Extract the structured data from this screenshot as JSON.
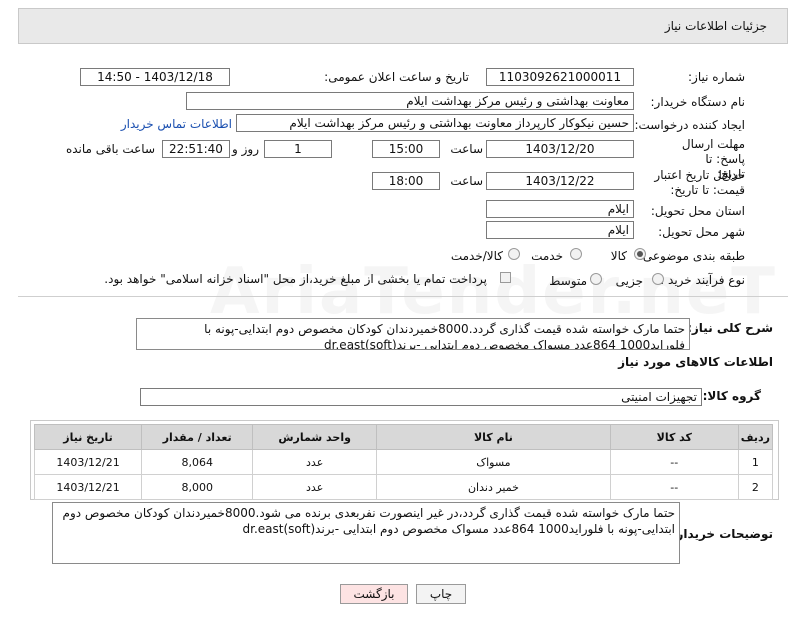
{
  "panel": {
    "title": "جزئیات اطلاعات نیاز"
  },
  "need_number": {
    "label": "شماره نیاز:",
    "value": "1103092621000011"
  },
  "announce": {
    "label": "تاریخ و ساعت اعلان عمومی:",
    "value": "1403/12/18 - 14:50"
  },
  "buyer_org": {
    "label": "نام دستگاه خریدار:",
    "value": "معاونت بهداشتی و رئیس مرکز بهداشت ایلام"
  },
  "creator": {
    "label": "ایجاد کننده درخواست:",
    "value": "حسین  نیکوکار کارپرداز  معاونت بهداشتی و رئیس مرکز بهداشت ایلام",
    "contact_link": "اطلاعات تماس خریدار"
  },
  "reply_deadline": {
    "label": "مهلت ارسال پاسخ: تا تاریخ:",
    "date": "1403/12/20",
    "time_label": "ساعت",
    "time": "15:00",
    "days": "1",
    "days_label": "روز و",
    "remaining": "22:51:40",
    "remaining_label": "ساعت باقی مانده"
  },
  "price_validity": {
    "label": "حداقل تاریخ اعتبار قیمت: تا تاریخ:",
    "date": "1403/12/22",
    "time_label": "ساعت",
    "time": "18:00"
  },
  "delivery_province": {
    "label": "استان محل تحویل:",
    "value": "ایلام"
  },
  "delivery_city": {
    "label": "شهر محل تحویل:",
    "value": "ایلام"
  },
  "category": {
    "label": "طبقه بندی موضوعی:",
    "options": [
      "کالا",
      "خدمت",
      "کالا/خدمت"
    ],
    "selected": "کالا"
  },
  "purchase_type": {
    "label": "نوع فرآیند خرید :",
    "options": [
      "جزیی",
      "متوسط"
    ],
    "selected": "",
    "payment_note": "پرداخت تمام یا بخشی از مبلغ خرید،از محل \"اسناد خزانه اسلامی\" خواهد بود."
  },
  "summary": {
    "label": "شرح کلی نیاز:",
    "text": "حتما مارک خواسته شده قیمت گذاری گردد.8000خمیردندان کودکان مخصوص دوم ابتدایی-پونه با فلوراید1000 864عدد مسواک مخصوص دوم ابتدایی -برندdr.east(soft)"
  },
  "goods_info": {
    "title": "اطلاعات کالاهای مورد نیاز"
  },
  "goods_group": {
    "label": "گروه کالا:",
    "value": "تجهیزات امنیتی"
  },
  "table": {
    "headers": [
      "ردیف",
      "کد کالا",
      "نام کالا",
      "واحد شمارش",
      "تعداد / مقدار",
      "تاریخ نیاز"
    ],
    "rows": [
      [
        "1",
        "--",
        "مسواک",
        "عدد",
        "8,064",
        "1403/12/21"
      ],
      [
        "2",
        "--",
        "خمیر دندان",
        "عدد",
        "8,000",
        "1403/12/21"
      ]
    ]
  },
  "buyer_notes": {
    "label": "توضیحات خریدار:",
    "text": "حتما مارک خواسته شده قیمت گذاری گردد،در غیر اینصورت نفربعدی برنده می شود.8000خمیردندان کودکان مخصوص دوم ابتدایی-پونه با فلوراید1000 864عدد مسواک مخصوص دوم ابتدایی -برندdr.east(soft)"
  },
  "buttons": {
    "print": "چاپ",
    "back": "بازگشت"
  },
  "watermark": "AriaTender.neT",
  "colors": {
    "link": "#1a4fb0",
    "back_button_bg": "#fde3e3",
    "header_bg": "#e9e9e9",
    "table_header_bg": "#d8d8d8"
  }
}
